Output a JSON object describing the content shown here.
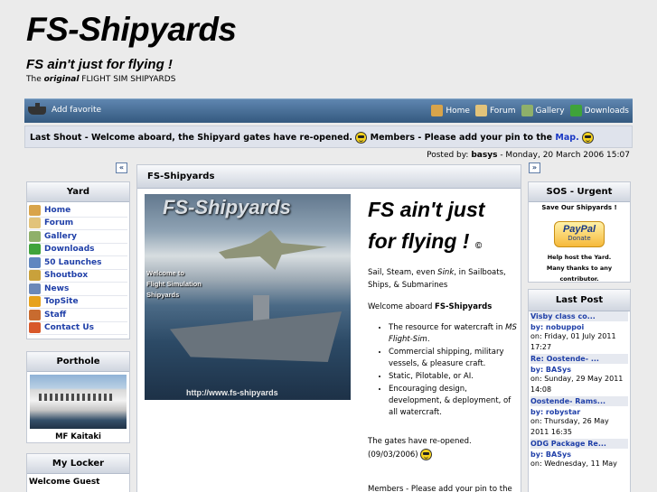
{
  "header": {
    "title": "FS-Shipyards",
    "slogan": "FS ain't just for flying !",
    "sub_prefix": "The ",
    "sub_original": "original",
    "sub_rest": " FLIGHT SIM SHIPYARDS"
  },
  "navbar": {
    "favorite": "Add favorite",
    "links": [
      {
        "label": "Home",
        "icon": "home-icon",
        "color": "#d9a44a"
      },
      {
        "label": "Forum",
        "icon": "forum-icon",
        "color": "#e2c37a"
      },
      {
        "label": "Gallery",
        "icon": "gallery-icon",
        "color": "#8fb06a"
      },
      {
        "label": "Downloads",
        "icon": "downloads-icon",
        "color": "#3fa33a"
      }
    ]
  },
  "shout": {
    "prefix": "Last Shout - Welcome aboard, the Shipyard gates have re-opened.",
    "middle": "Members - Please add your pin to the",
    "map": "Map."
  },
  "posted": {
    "label": "Posted by:",
    "author": "basys",
    "date": "- Monday, 20 March 2006 15:07"
  },
  "yard": {
    "title": "Yard",
    "items": [
      {
        "label": "Home",
        "icon": "home-icon",
        "color": "#d9a44a"
      },
      {
        "label": "Forum",
        "icon": "forum-icon",
        "color": "#e2c37a"
      },
      {
        "label": "Gallery",
        "icon": "gallery-icon",
        "color": "#8fb06a"
      },
      {
        "label": "Downloads",
        "icon": "downloads-icon",
        "color": "#3fa33a"
      },
      {
        "label": "50 Launches",
        "icon": "launches-icon",
        "color": "#5f86c0"
      },
      {
        "label": "Shoutbox",
        "icon": "shoutbox-icon",
        "color": "#c9a13b"
      },
      {
        "label": "News",
        "icon": "news-icon",
        "color": "#6b88b8"
      },
      {
        "label": "TopSite",
        "icon": "topsite-icon",
        "color": "#e7a21b"
      },
      {
        "label": "Staff",
        "icon": "staff-icon",
        "color": "#c86b2f"
      },
      {
        "label": "Contact Us",
        "icon": "contact-icon",
        "color": "#d8582a"
      }
    ]
  },
  "porthole": {
    "title": "Porthole",
    "caption": "MF Kaitaki"
  },
  "locker": {
    "title": "My Locker",
    "greeting": "Welcome Guest"
  },
  "main": {
    "title": "FS-Shipyards",
    "image_title": "FS-Shipyards",
    "image_text": "Welcome to\nFlight Simulation\nShipyards",
    "image_url": "http://www.fs-shipyards",
    "tagline": "FS ain't just for flying !",
    "copyright": "©",
    "intro_1": "Sail, Steam, even ",
    "intro_sink": "Sink",
    "intro_2": ", in Sailboats, Ships, & Submarines",
    "welcome_prefix": "Welcome aboard ",
    "welcome_name": "FS-Shipyards",
    "bullets": [
      {
        "text": "The resource for watercraft in ",
        "em": "MS Flight-Sim",
        "after": "."
      },
      {
        "text": "Commercial shipping, military vessels, & pleasure craft.",
        "em": "",
        "after": ""
      },
      {
        "text": "Static, Pilotable, or AI.",
        "em": "",
        "after": ""
      },
      {
        "text": "Encouraging design, development, & deployment, of all watercraft.",
        "em": "",
        "after": ""
      }
    ],
    "gates": "The gates have re-opened.",
    "gates_date": "(09/03/2006)",
    "members": "Members - Please add your pin to the"
  },
  "sos": {
    "title": "SOS - Urgent",
    "sub": "Save Our Shipyards !",
    "paypal": "PayPal",
    "donate": "Donate",
    "help": "Help host the Yard.",
    "thanks": "Many thanks to any contributor."
  },
  "lastpost": {
    "title": "Last Post",
    "posts": [
      {
        "title": "Visby class co...",
        "by": "by: nobuppoi",
        "date": "on: Friday, 01 July 2011 17:27"
      },
      {
        "title": "Re: Oostende- ...",
        "by": "by: BASys",
        "date": "on: Sunday, 29 May 2011 14:08"
      },
      {
        "title": "Oostende- Rams...",
        "by": "by: robystar",
        "date": "on: Thursday, 26 May 2011 16:35"
      },
      {
        "title": "ODG Package Re...",
        "by": "by: BASys",
        "date": "on: Wednesday, 11 May"
      }
    ]
  }
}
